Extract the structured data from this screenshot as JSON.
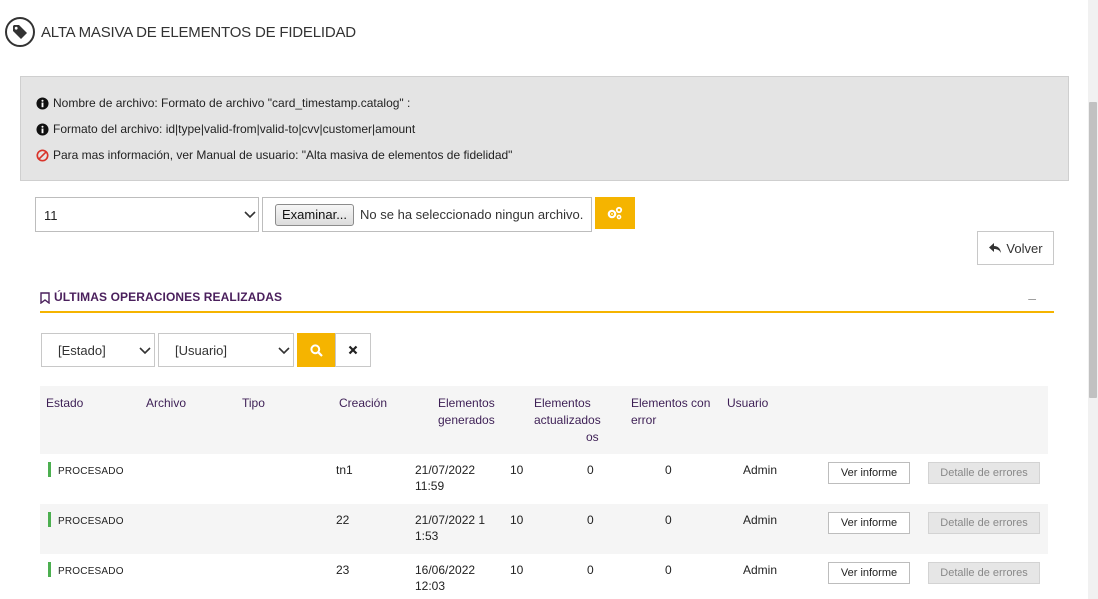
{
  "header": {
    "title": "ALTA MASIVA DE ELEMENTOS DE FIDELIDAD",
    "icon": "tag-icon"
  },
  "info": [
    {
      "icon": "info-icon",
      "text": "Nombre de archivo: Formato de archivo \"card_timestamp.catalog\" :"
    },
    {
      "icon": "info-icon",
      "text": "Formato del archivo: id|type|valid-from|valid-to|cvv|customer|amount"
    },
    {
      "icon": "ban-icon",
      "text": "Para mas información, ver Manual de usuario: \"Alta masiva de elementos de fidelidad\""
    }
  ],
  "upload": {
    "select_value": "11",
    "browse_label": "Examinar...",
    "file_status": "No se ha seleccionado ningun archivo.",
    "process_icon": "gears-icon"
  },
  "volver_label": "Volver",
  "section": {
    "title": "ÚLTIMAS OPERACIONES REALIZADAS",
    "collapse": "–"
  },
  "filters": {
    "estado": "[Estado]",
    "usuario": "[Usuario]"
  },
  "table": {
    "headers": {
      "estado": "Estado",
      "archivo": "Archivo",
      "tipo": "Tipo",
      "creacion": "Creación",
      "generados_1": "Elementos",
      "generados_2": "generados",
      "actualizados_1": "Elementos",
      "actualizados_2": "actualizados",
      "actualizados_3": "os",
      "error_1": "Elementos con",
      "error_2": "error",
      "usuario": "Usuario"
    },
    "rows": [
      {
        "estado": "PROCESADO",
        "tipo": "tn1",
        "creacion_1": "21/07/2022",
        "creacion_2": "11:59",
        "generados": "10",
        "actualizados": "0",
        "error": "0",
        "usuario": "Admin",
        "btn_informe": "Ver informe",
        "btn_errores": "Detalle de errores"
      },
      {
        "estado": "PROCESADO",
        "tipo": "22",
        "creacion_1": "21/07/2022 1",
        "creacion_2": "1:53",
        "generados": "10",
        "actualizados": "0",
        "error": "0",
        "usuario": "Admin",
        "btn_informe": "Ver informe",
        "btn_errores": "Detalle de errores"
      },
      {
        "estado": "PROCESADO",
        "tipo": "23",
        "creacion_1": "16/06/2022",
        "creacion_2": "12:03",
        "generados": "10",
        "actualizados": "0",
        "error": "0",
        "usuario": "Admin",
        "btn_informe": "Ver informe",
        "btn_errores": "Detalle de errores"
      }
    ]
  },
  "colors": {
    "accent": "#f5b400",
    "heading": "#4a1f5c",
    "status_ok": "#4caf50"
  }
}
